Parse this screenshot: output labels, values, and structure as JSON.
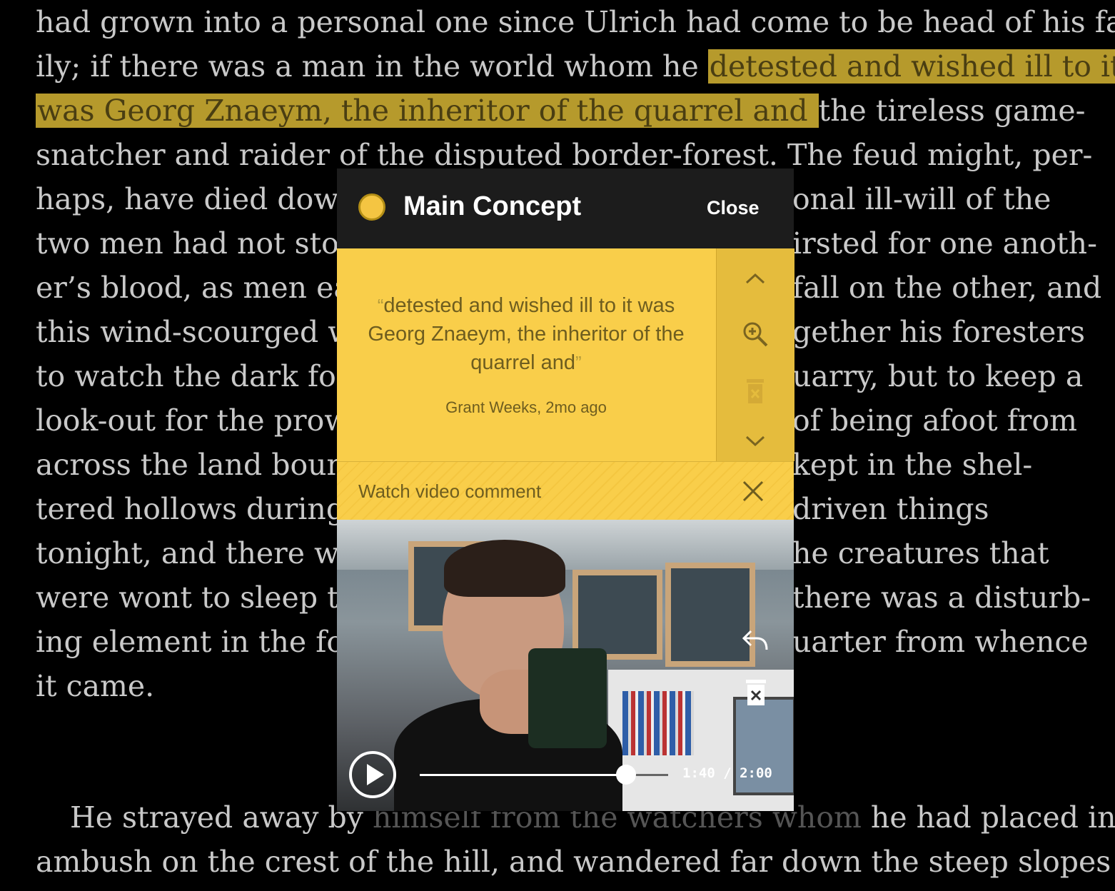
{
  "book": {
    "lines": [
      {
        "pre": "had grown into a personal one since Ulrich had come to be head of his fam-",
        "hl": "",
        "post": ""
      },
      {
        "pre": "ily; if there was a man in the world whom he ",
        "hl": "detested and wished ill to it",
        "post": ""
      },
      {
        "pre": "",
        "hl": "was Georg Znaeym, the inheritor of the quarrel and ",
        "post": "the tireless game-"
      },
      {
        "pre": "snatcher and raider of the disputed border-forest. The feud might, per-",
        "hl": "",
        "post": ""
      },
      {
        "pre": "haps, have died down",
        "hl": "",
        "post": ""
      },
      {
        "pre": "two men had not stoo",
        "hl": "",
        "post": ""
      },
      {
        "pre": "er’s blood, as men eac",
        "hl": "",
        "post": ""
      },
      {
        "pre": "this wind-scourged w",
        "hl": "",
        "post": ""
      },
      {
        "pre": "to watch the dark fore",
        "hl": "",
        "post": ""
      },
      {
        "pre": "look-out for the prow",
        "hl": "",
        "post": ""
      },
      {
        "pre": "across the land bound",
        "hl": "",
        "post": ""
      },
      {
        "pre": "tered hollows during a",
        "hl": "",
        "post": ""
      },
      {
        "pre": "tonight, and there wa",
        "hl": "",
        "post": ""
      },
      {
        "pre": "were wont to sleep th",
        "hl": "",
        "post": ""
      },
      {
        "pre": "ing element in the for",
        "hl": "",
        "post": ""
      },
      {
        "pre": "it came.",
        "hl": "",
        "post": ""
      }
    ],
    "right_fragments": [
      "onal ill-will of the",
      "irsted for one anoth-",
      "fall on the other, and",
      "gether his foresters",
      "uarry, but to keep a",
      "of being afoot from",
      " kept in the shel-",
      "driven things",
      "he creatures that",
      "there was a disturb-",
      "uarter from whence"
    ],
    "para2_line1_pre": "He strayed away by ",
    "para2_line1_dim": "himself from the watchers whom",
    "para2_line1_post": " he had placed in",
    "para2_line2": "ambush on the crest of the hill, and wandered far down the steep slopes"
  },
  "popup": {
    "title": "Main Concept",
    "close_label": "Close",
    "quote": "detested and wished ill to it was Georg Znaeym, the inheritor of the quarrel and",
    "open_quote": "“",
    "close_quote": "”",
    "author_line": "Grant Weeks, 2mo ago",
    "video_label": "Watch video comment",
    "dot_color": "#f4c542",
    "accent": "#f9ce4a"
  },
  "video": {
    "time": "1:40 / 2:00",
    "progress": 0.83
  }
}
